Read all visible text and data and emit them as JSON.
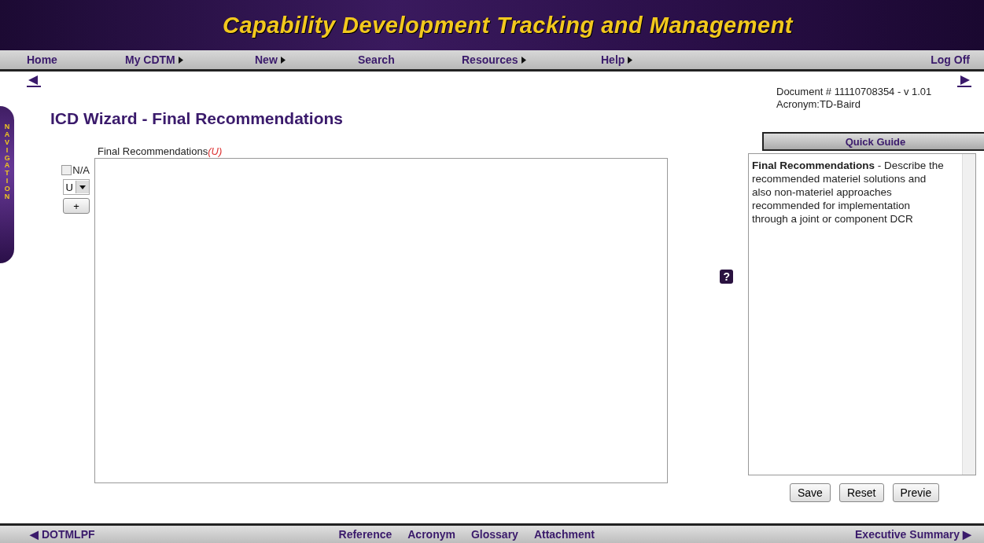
{
  "header": {
    "title": "Capability Development Tracking and Management"
  },
  "menu": [
    {
      "label": "Home",
      "submenu": false
    },
    {
      "label": "My CDTM",
      "submenu": true
    },
    {
      "label": "New",
      "submenu": true
    },
    {
      "label": "Search",
      "submenu": false
    },
    {
      "label": "Resources",
      "submenu": true
    },
    {
      "label": "Help",
      "submenu": true
    }
  ],
  "logoff": "Log Off",
  "side_tab": "NAVIGATION",
  "page_title": "ICD Wizard - Final Recommendations",
  "document": {
    "number": "Document # 11110708354 - v 1.01",
    "acronym": "Acronym:TD-Baird"
  },
  "field": {
    "label": "Final Recommendations",
    "marking": "(U)"
  },
  "na": {
    "label": "N/A",
    "checked": false
  },
  "classification": {
    "value": "U"
  },
  "add_button": "+",
  "help_icon": "?",
  "quick_guide": {
    "title": "Quick Guide",
    "text": "**Final Recommendations** - Describe the recommended materiel solutions and also non-materiel approaches recommended for implementation through a joint or component DCR"
  },
  "buttons": [
    "Save",
    "Reset",
    "Previe"
  ],
  "footer": {
    "prev": "◀ DOTMLPF",
    "links": [
      "Reference",
      "Acronym",
      "Glossary",
      "Attachment"
    ],
    "next": "Executive Summary ▶"
  }
}
